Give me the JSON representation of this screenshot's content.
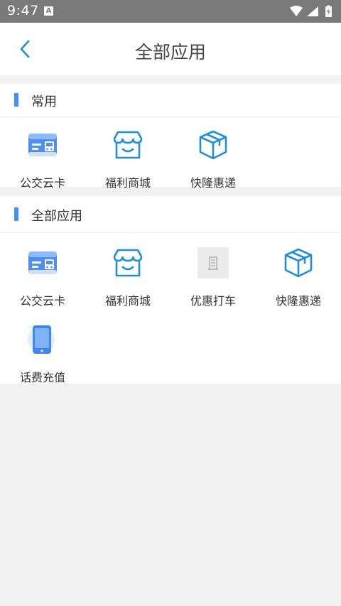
{
  "status_bar": {
    "time": "9:47",
    "indicator": "A"
  },
  "header": {
    "title": "全部应用",
    "back_icon": "chevron-left-icon"
  },
  "sections": {
    "common": {
      "title": "常用",
      "items": [
        {
          "label": "公交云卡",
          "icon": "bus-card-icon"
        },
        {
          "label": "福利商城",
          "icon": "shop-icon"
        },
        {
          "label": "快隆惠递",
          "icon": "package-icon"
        }
      ]
    },
    "all": {
      "title": "全部应用",
      "items": [
        {
          "label": "公交云卡",
          "icon": "bus-card-icon"
        },
        {
          "label": "福利商城",
          "icon": "shop-icon"
        },
        {
          "label": "优惠打车",
          "icon": "image-placeholder-icon"
        },
        {
          "label": "快隆惠递",
          "icon": "package-icon"
        },
        {
          "label": "话费充值",
          "icon": "phone-icon"
        }
      ]
    }
  },
  "colors": {
    "accent": "#4a90f0",
    "icon_blue": "#1e8fd8",
    "status_bar": "#7a7a7a",
    "background": "#f2f2f2"
  }
}
